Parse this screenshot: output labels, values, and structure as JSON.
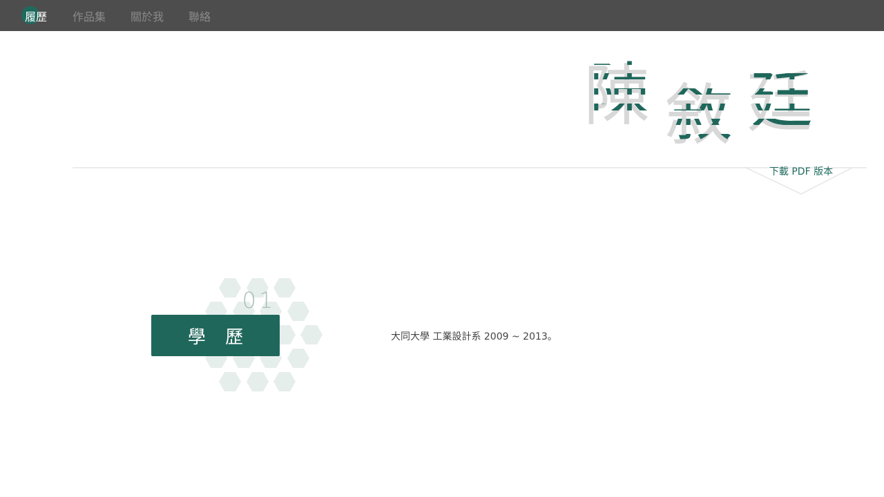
{
  "nav": {
    "items": [
      {
        "label": "履歷",
        "active": true
      },
      {
        "label": "作品集",
        "active": false
      },
      {
        "label": "關於我",
        "active": false
      },
      {
        "label": "聯絡",
        "active": false
      }
    ]
  },
  "header": {
    "name_chars": [
      "陳",
      "敘",
      "廷"
    ]
  },
  "pdf": {
    "label": "下載 PDF 版本"
  },
  "sections": [
    {
      "number": "01",
      "title": "學 歷",
      "content": "大同大學 工業設計系 2009 ~ 2013。"
    }
  ],
  "colors": {
    "nav_bg": "#4d4d4d",
    "accent": "#1f675b",
    "muted_green": "#a9bfb8",
    "hex_fill": "#e6eeec",
    "shadow_gray": "#d6d6d6"
  }
}
